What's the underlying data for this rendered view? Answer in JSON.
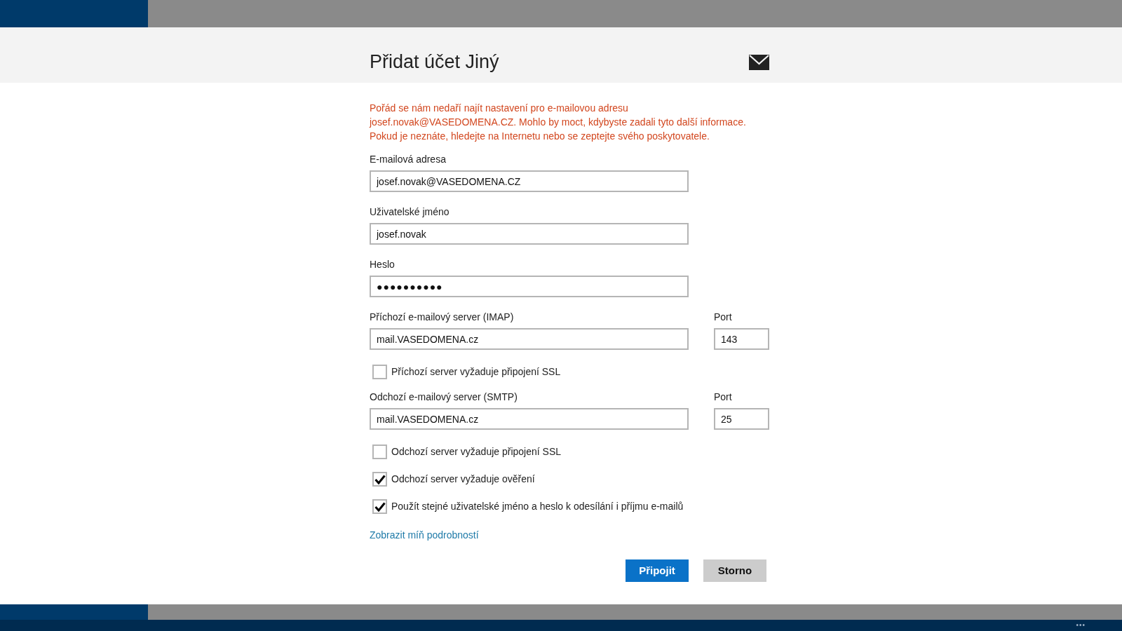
{
  "dialog": {
    "title": "Přidat účet Jiný",
    "message": "Pořád se nám nedaří najít nastavení pro e-mailovou adresu josef.novak@VASEDOMENA.CZ. Mohlo by moct, kdybyste zadali tyto další informace. Pokud je neznáte, hledejte na Internetu nebo se zeptejte svého poskytovatele.",
    "form": [
      {
        "kind": "field",
        "label": "E-mailová adresa",
        "value": "josef.novak@VASEDOMENA.CZ"
      },
      {
        "kind": "field",
        "label": "Uživatelské jméno",
        "value": "josef.novak"
      },
      {
        "kind": "password",
        "label": "Heslo",
        "value": "●●●●●●●●●●"
      },
      {
        "kind": "server",
        "label": "Příchozí e-mailový server (IMAP)",
        "value": "mail.VASEDOMENA.cz",
        "port_label": "Port",
        "port": "143"
      },
      {
        "kind": "checkbox",
        "label": "Příchozí server vyžaduje připojení SSL",
        "checked": false
      },
      {
        "kind": "server",
        "label": "Odchozí e-mailový server (SMTP)",
        "value": "mail.VASEDOMENA.cz",
        "port_label": "Port",
        "port": "25"
      },
      {
        "kind": "checkbox",
        "label": "Odchozí server vyžaduje připojení SSL",
        "checked": false
      },
      {
        "kind": "checkbox",
        "label": "Odchozí server vyžaduje ověření",
        "checked": true
      },
      {
        "kind": "checkbox",
        "label": "Použít stejné uživatelské jméno a heslo k odesílání i příjmu e-mailů",
        "checked": true
      }
    ],
    "link": "Zobrazit míň podrobností",
    "buttons": [
      {
        "label": "Připojit",
        "primary": true
      },
      {
        "label": "Storno",
        "primary": false
      }
    ]
  },
  "app_bar": {
    "more": "•••"
  }
}
